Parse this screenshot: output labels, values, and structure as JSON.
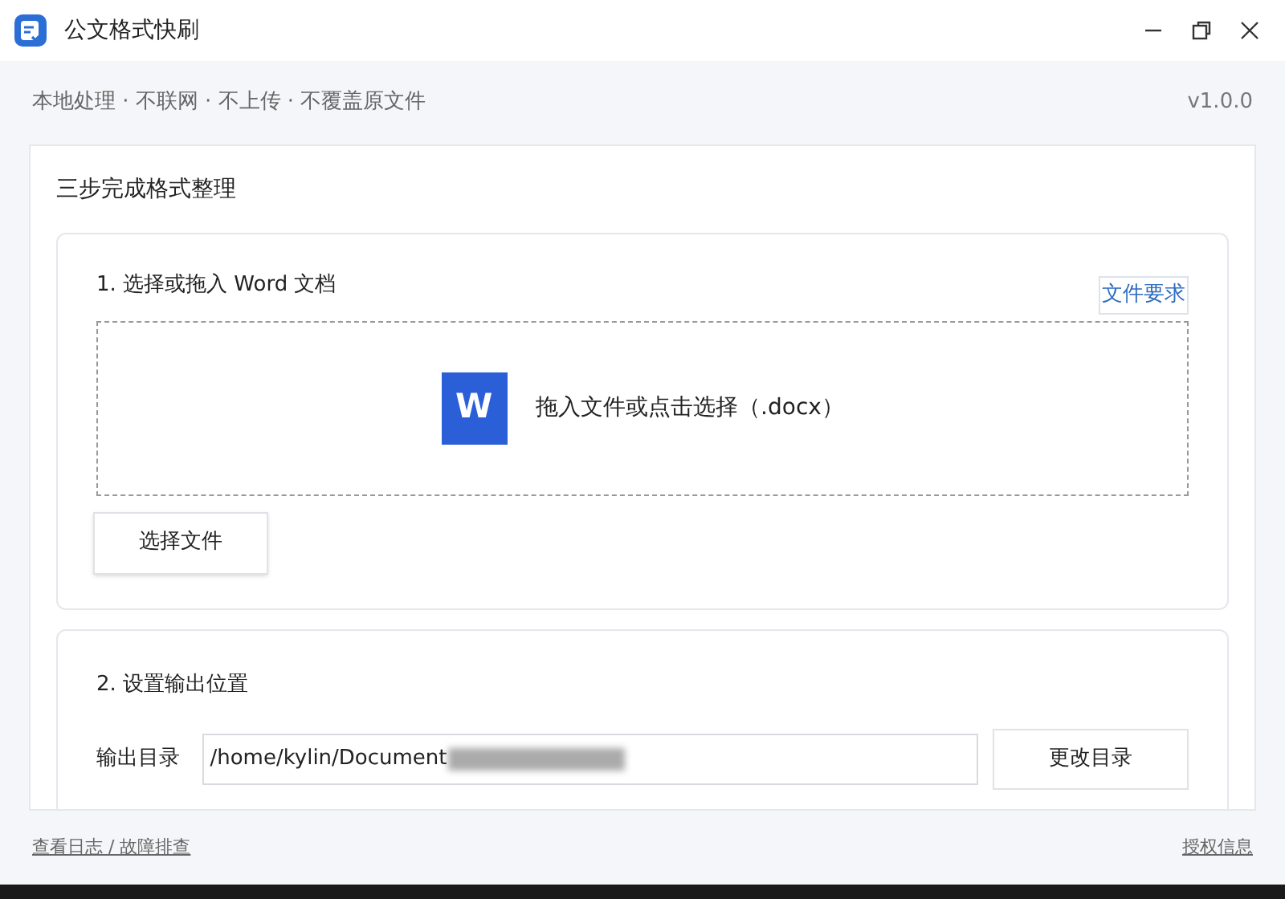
{
  "window": {
    "title": "公文格式快刷"
  },
  "info": {
    "tagline": "本地处理 · 不联网 · 不上传 · 不覆盖原文件",
    "version": "v1.0.0"
  },
  "main": {
    "title": "三步完成格式整理",
    "step1": {
      "title": "1. 选择或拖入 Word 文档",
      "requirements_link": "文件要求",
      "drop_icon_letter": "W",
      "drop_hint": "拖入文件或点击选择（.docx）",
      "button": "选择文件"
    },
    "step2": {
      "title": "2. 设置输出位置",
      "label": "输出目录",
      "value": "/home/kylin/Document",
      "button": "更改目录"
    }
  },
  "footer": {
    "left_link": "查看日志 / 故障排查",
    "right_link": "授权信息"
  }
}
